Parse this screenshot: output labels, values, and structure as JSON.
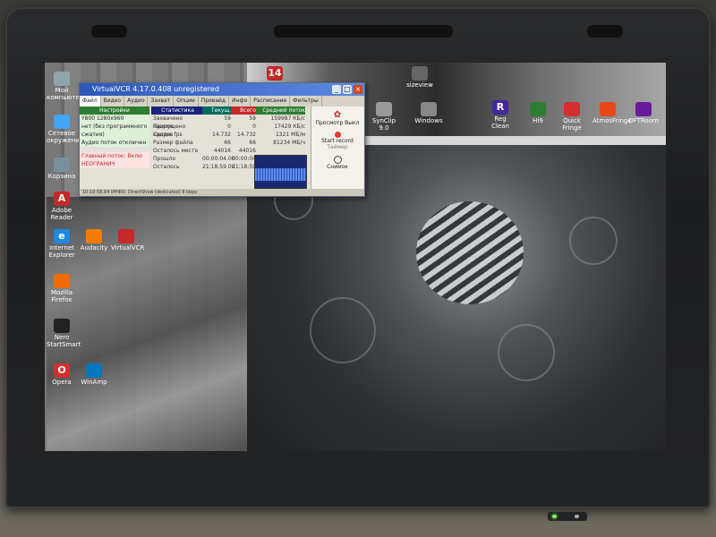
{
  "window": {
    "title": "VirtualVCR 4.17.0.408 unregistered",
    "tabs": [
      "Файл",
      "Видео",
      "Аудио",
      "Захват",
      "Опции",
      "Провайд",
      "Инфо",
      "Расписание",
      "Фильтры"
    ],
    "settings_header": "Настройки",
    "settings_lines": [
      "Y800 1280x960",
      "нет (без программного",
      "сжатия)",
      "Аудио поток отключен"
    ],
    "status_lines": [
      "Главный поток: Вклю",
      "НЕОГРАНИЧ"
    ],
    "columns": [
      "Статистика",
      "Текущ.",
      "Всего",
      "Средний поток"
    ],
    "rows": [
      {
        "label": "Захвачено кадров",
        "cur": "59",
        "total": "59",
        "avg": "159987 КБ/с"
      },
      {
        "label": "Пропущено кадров",
        "cur": "0",
        "total": "0",
        "avg": "17429 КБ/с"
      },
      {
        "label": "Средн. fps",
        "cur": "14.732",
        "total": "14.732",
        "avg": "1321 МБ/м"
      },
      {
        "label": "Размер файла",
        "cur": "66",
        "total": "66",
        "avg": "81234 МБ/ч"
      },
      {
        "label": "Осталось места",
        "cur": "44016",
        "total": "44016",
        "avg": ""
      },
      {
        "label": "Прошло",
        "cur": "00:00:04.00",
        "total": "00:00:04",
        "avg": ""
      },
      {
        "label": "Осталось",
        "cur": "21:18:59.00",
        "total": "21:18:59",
        "avg": ""
      }
    ],
    "buttons": {
      "preview": "Просмотр Выкл",
      "record": "Start record",
      "timer": "Таймер",
      "snapshot": "Снимок"
    },
    "statusbar": "10:10:58.84 ИНФО: DirectShow (dedicated) 8 kbps"
  },
  "desktop_icons_left": [
    "Мой компьютер",
    "Сетевое окружение",
    "Корзина",
    "Adobe Reader",
    "Internet Explorer",
    "Audacity",
    "VirtualVCR",
    "Mozilla Firefox",
    "Nero StartSmart",
    "Opera",
    "WinAmp"
  ],
  "desktop_icons_top": [
    "14",
    "sizeview",
    "SynClip 9.0",
    "Windows",
    "Reg Clean",
    "Hi9",
    "ColorMode",
    "Quick Fringe",
    "AtmosFringe",
    "OFTRoom"
  ],
  "colors": {
    "titlebar": "#2e58b6",
    "settings_header": "#2e7d32",
    "stat_header": "#1a237e",
    "record_dot": "#e53935",
    "power_led": "#7cf55a"
  }
}
